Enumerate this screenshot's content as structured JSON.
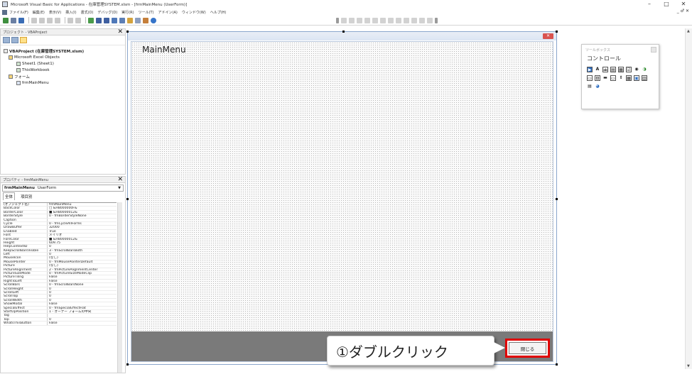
{
  "window": {
    "title": "Microsoft Visual Basic for Applications - 在庫管理SYSTEM.xlsm - [frmMainMenu (UserForm)]",
    "minimize": "–",
    "maximize": "□",
    "close": "✕",
    "mdi_controls": "_ ♂ ✕"
  },
  "menubar": {
    "items": [
      "ファイル(F)",
      "編集(E)",
      "表示(V)",
      "挿入(I)",
      "書式(O)",
      "デバッグ(D)",
      "実行(R)",
      "ツール(T)",
      "アドイン(A)",
      "ウィンドウ(W)",
      "ヘルプ(H)"
    ]
  },
  "project_explorer": {
    "title": "プロジェクト - VBAProject",
    "close": "✕",
    "tree": [
      {
        "label": "VBAProject (在庫管理SYSTEM.xlsm)",
        "bold": true,
        "indent": 0
      },
      {
        "label": "Microsoft Excel Objects",
        "bold": false,
        "indent": 1
      },
      {
        "label": "Sheet1 (Sheet1)",
        "bold": false,
        "indent": 2
      },
      {
        "label": "ThisWorkbook",
        "bold": false,
        "indent": 2
      },
      {
        "label": "フォーム",
        "bold": false,
        "indent": 1
      },
      {
        "label": "frmMainMenu",
        "bold": false,
        "indent": 2
      }
    ]
  },
  "properties": {
    "title": "プロパティ - frmMainMenu",
    "close": "✕",
    "object_name": "frmMainMenu",
    "object_type": "UserForm",
    "tabs": [
      "全体",
      "項目別"
    ],
    "rows": [
      [
        "(オブジェクト名)",
        "frmMainMenu"
      ],
      [
        "BackColor",
        "□ &H8000000F&"
      ],
      [
        "BorderColor",
        "■ &H80000012&"
      ],
      [
        "BorderStyle",
        "0 - fmBorderStyleNone"
      ],
      [
        "Caption",
        ""
      ],
      [
        "Cycle",
        "0 - fmCycleAllForms"
      ],
      [
        "DrawBuffer",
        "32000"
      ],
      [
        "Enabled",
        "True"
      ],
      [
        "Font",
        "メイリオ"
      ],
      [
        "ForeColor",
        "■ &H80000012&"
      ],
      [
        "Height",
        "609.75"
      ],
      [
        "HelpContextID",
        "0"
      ],
      [
        "KeepScrollBarsVisible",
        "3 - fmScrollBarsBoth"
      ],
      [
        "Left",
        "0"
      ],
      [
        "MouseIcon",
        "(なし)"
      ],
      [
        "MousePointer",
        "0 - fmMousePointerDefault"
      ],
      [
        "Picture",
        "(なし)"
      ],
      [
        "PictureAlignment",
        "2 - fmPictureAlignmentCenter"
      ],
      [
        "PictureSizeMode",
        "0 - fmPictureSizeModeClip"
      ],
      [
        "PictureTiling",
        "False"
      ],
      [
        "RightToLeft",
        "False"
      ],
      [
        "ScrollBars",
        "0 - fmScrollBarsNone"
      ],
      [
        "ScrollHeight",
        "0"
      ],
      [
        "ScrollLeft",
        "0"
      ],
      [
        "ScrollTop",
        "0"
      ],
      [
        "ScrollWidth",
        "0"
      ],
      [
        "ShowModal",
        "False"
      ],
      [
        "SpecialEffect",
        "0 - fmSpecialEffectFlat"
      ],
      [
        "StartUpPosition",
        "1 - オーナー フォームの中央"
      ],
      [
        "Tag",
        ""
      ],
      [
        "Top",
        "0"
      ],
      [
        "WhatsThisButton",
        "False"
      ]
    ]
  },
  "userform": {
    "title": "MainMenu",
    "close_button_label": "閉じる",
    "titlebar_close": "✕"
  },
  "callout": {
    "text": "①ダブルクリック"
  },
  "toolbox": {
    "title": "ツールボックス",
    "tab": "コントロール",
    "row1": [
      "▶",
      "A",
      "ab",
      "▤",
      "▦",
      "☑",
      "◉",
      "◑"
    ],
    "row2": [
      "▭",
      "⊡",
      "▬",
      "▭",
      "⇕",
      "▦",
      "▣",
      "▥"
    ],
    "row3": [
      "▤",
      "◕"
    ]
  },
  "colors": {
    "accent_red": "#e00000",
    "form_footer": "#7a7a7a"
  }
}
